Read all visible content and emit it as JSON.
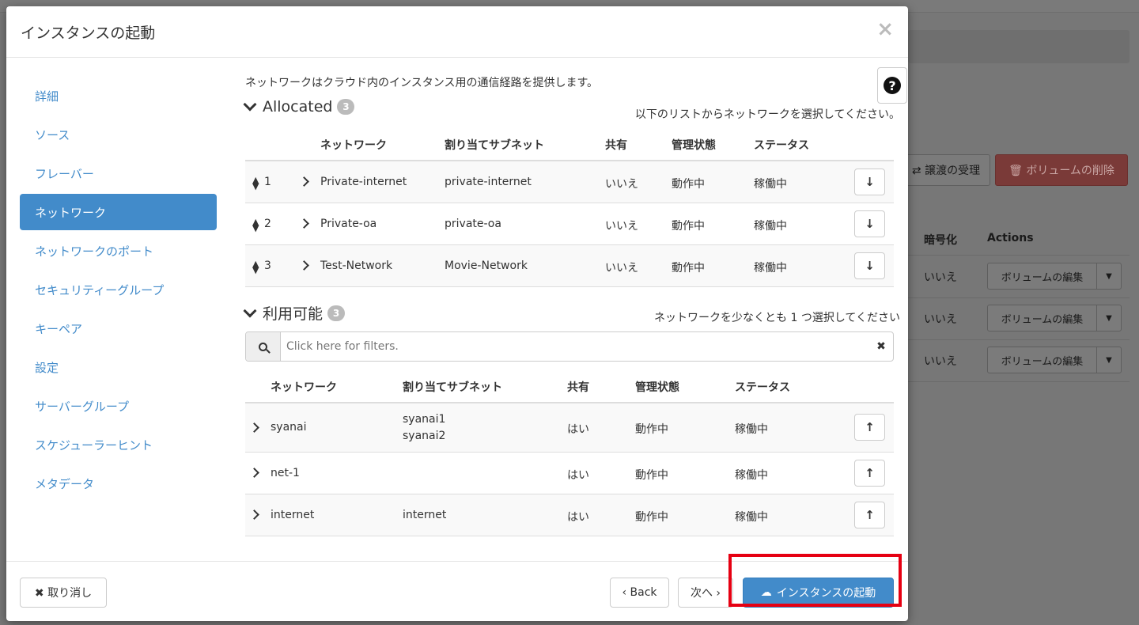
{
  "background": {
    "buttons": {
      "transfer": "⇄ 譲渡の受理",
      "delete": "🗑 ボリュームの削除"
    },
    "headers": {
      "encryption": "暗号化",
      "actions": "Actions"
    },
    "rows": [
      {
        "encryption": "いいえ",
        "edit": "ボリュームの編集"
      },
      {
        "encryption": "いいえ",
        "edit": "ボリュームの編集"
      },
      {
        "encryption": "いいえ",
        "edit": "ボリュームの編集"
      }
    ]
  },
  "modal": {
    "title": "インスタンスの起動",
    "close": "×",
    "help": "?",
    "sidebar": [
      {
        "label": "詳細"
      },
      {
        "label": "ソース"
      },
      {
        "label": "フレーバー"
      },
      {
        "label": "ネットワーク",
        "active": true
      },
      {
        "label": "ネットワークのポート"
      },
      {
        "label": "セキュリティーグループ"
      },
      {
        "label": "キーペア"
      },
      {
        "label": "設定"
      },
      {
        "label": "サーバーグループ"
      },
      {
        "label": "スケジューラーヒント"
      },
      {
        "label": "メタデータ"
      }
    ],
    "intro": "ネットワークはクラウド内のインスタンス用の通信経路を提供します。",
    "allocated": {
      "title": "Allocated",
      "count": "3",
      "hint": "以下のリストからネットワークを選択してください。",
      "columns": [
        "ネットワーク",
        "割り当てサブネット",
        "共有",
        "管理状態",
        "ステータス"
      ],
      "rows": [
        {
          "order": "1",
          "network": "Private-internet",
          "subnet": "private-internet",
          "shared": "いいえ",
          "admin": "動作中",
          "status": "稼働中"
        },
        {
          "order": "2",
          "network": "Private-oa",
          "subnet": "private-oa",
          "shared": "いいえ",
          "admin": "動作中",
          "status": "稼働中"
        },
        {
          "order": "3",
          "network": "Test-Network",
          "subnet": "Movie-Network",
          "shared": "いいえ",
          "admin": "動作中",
          "status": "稼働中"
        }
      ]
    },
    "available": {
      "title": "利用可能",
      "count": "3",
      "hint": "ネットワークを少なくとも 1 つ選択してください",
      "filter_placeholder": "Click here for filters.",
      "columns": [
        "ネットワーク",
        "割り当てサブネット",
        "共有",
        "管理状態",
        "ステータス"
      ],
      "rows": [
        {
          "network": "syanai",
          "subnet": "syanai1",
          "subnet2": "syanai2",
          "shared": "はい",
          "admin": "動作中",
          "status": "稼働中"
        },
        {
          "network": "net-1",
          "subnet": "",
          "subnet2": "",
          "shared": "はい",
          "admin": "動作中",
          "status": "稼働中"
        },
        {
          "network": "internet",
          "subnet": "internet",
          "subnet2": "",
          "shared": "はい",
          "admin": "動作中",
          "status": "稼働中"
        }
      ]
    },
    "footer": {
      "cancel": "✖ 取り消し",
      "back": "‹ Back",
      "next": "次へ ›",
      "launch": "インスタンスの起動"
    }
  }
}
